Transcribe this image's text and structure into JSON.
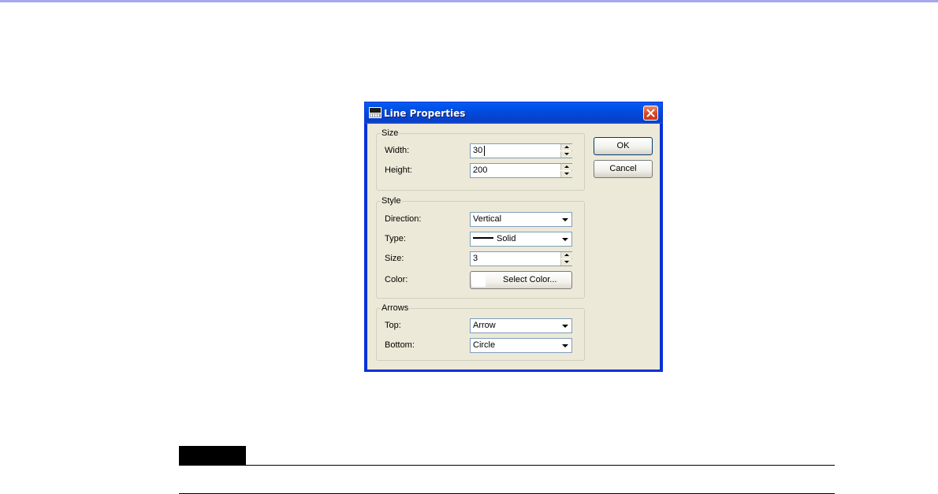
{
  "dialog": {
    "title": "Line Properties",
    "app_icon": "dme-icon",
    "close_icon": "close-icon"
  },
  "size_group": {
    "legend": "Size",
    "width_label": "Width:",
    "width_value": "30",
    "height_label": "Height:",
    "height_value": "200"
  },
  "style_group": {
    "legend": "Style",
    "direction_label": "Direction:",
    "direction_value": "Vertical",
    "type_label": "Type:",
    "type_value": "Solid",
    "size_label": "Size:",
    "size_value": "3",
    "color_label": "Color:",
    "color_button": "Select Color...",
    "color_swatch": "#ffffff"
  },
  "arrows_group": {
    "legend": "Arrows",
    "top_label": "Top:",
    "top_value": "Arrow",
    "bottom_label": "Bottom:",
    "bottom_value": "Circle"
  },
  "buttons": {
    "ok": "OK",
    "cancel": "Cancel"
  }
}
